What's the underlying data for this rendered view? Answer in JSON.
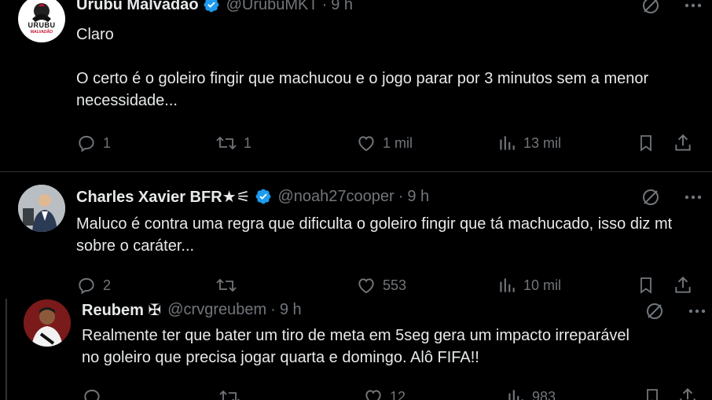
{
  "posts": [
    {
      "author": "Urubu Malvadão",
      "handle": "@UrubuMKT",
      "time": "9 h",
      "avatar_text": "URUBU",
      "avatar_subtext": "MALVADÃO",
      "text": "Claro\n\nO certo é o goleiro fingir que machucou e o jogo parar por 3 minutos sem a menor necessidade...",
      "replies": "1",
      "reposts": "1",
      "likes": "1 mil",
      "views": "13 mil"
    },
    {
      "author": "Charles Xavier BFR★⚟",
      "handle": "@noah27cooper",
      "time": "9 h",
      "text": "Maluco é contra uma regra que dificulta o goleiro fingir que tá machucado, isso diz mt sobre o caráter...",
      "replies": "2",
      "reposts": "",
      "likes": "553",
      "views": "10 mil"
    },
    {
      "author": "Reubem ✠",
      "handle": "@crvgreubem",
      "time": "9 h",
      "text": "Realmente ter que bater um tiro de meta em 5seg gera um impacto irreparável no goleiro que precisa jogar quarta e domingo. Alô FIFA!!",
      "replies": "",
      "reposts": "",
      "likes": "12",
      "views": "983"
    }
  ],
  "colors": {
    "background": "#000000",
    "text": "#e7e9ea",
    "muted": "#71767b",
    "verified": "#1d9bf0",
    "divider": "#2f3336"
  },
  "icons": [
    "verified-badge-icon",
    "grok-icon",
    "more-icon",
    "reply-icon",
    "repost-icon",
    "like-icon",
    "views-icon",
    "bookmark-icon",
    "share-icon"
  ]
}
